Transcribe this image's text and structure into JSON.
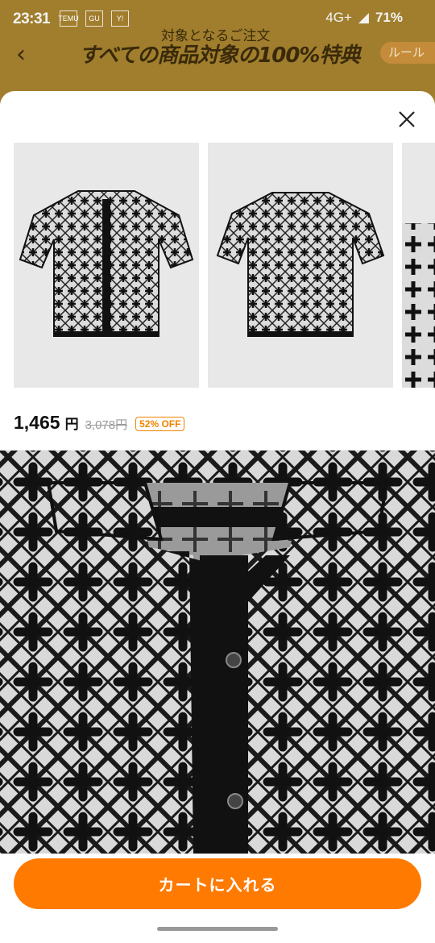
{
  "status_bar": {
    "time": "23:31",
    "icons": [
      "TEMU",
      "GU",
      "Y!"
    ],
    "network": "4G+",
    "battery": "71%"
  },
  "banner": {
    "subtitle": "対象となるご注文",
    "title": "すべての商品対象の100%特典",
    "rule_button": "ルール"
  },
  "product": {
    "price": "1,465",
    "price_unit": "円",
    "original_price": "3,078円",
    "discount_badge": "52% OFF"
  },
  "footer": {
    "cart_button": "カートに入れる"
  },
  "colors": {
    "accent": "#ff7a00",
    "discount": "#f08300"
  }
}
